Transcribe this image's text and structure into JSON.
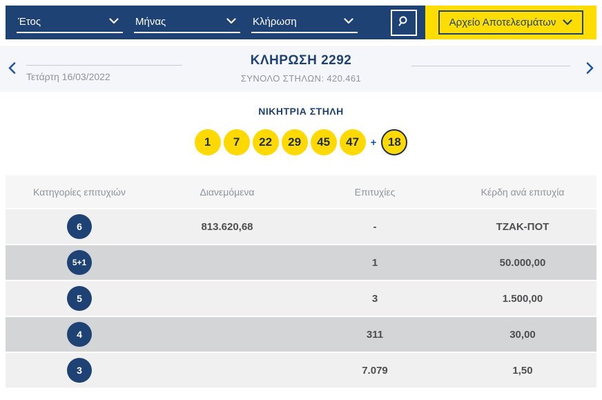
{
  "filters": {
    "year_label": "Έτος",
    "month_label": "Μήνας",
    "draw_label": "Κλήρωση",
    "archive_button_label": "Αρχείο Αποτελεσμάτων"
  },
  "draw_nav": {
    "date": "Τετάρτη 16/03/2022",
    "title": "ΚΛΗΡΩΣΗ 2292",
    "total_columns": "ΣΥΝΟΛΟ ΣΤΗΛΩΝ: 420.461"
  },
  "winning": {
    "title": "ΝΙΚΗΤΡΙΑ ΣΤΗΛΗ",
    "numbers": [
      "1",
      "7",
      "22",
      "29",
      "45",
      "47"
    ],
    "plus_sign": "+",
    "joker_number": "18"
  },
  "table": {
    "headers": [
      "Κατηγορίες επιτυχιών",
      "Διανεμόμενα",
      "Επιτυχίες",
      "Κέρδη ανά επιτυχία"
    ],
    "rows": [
      {
        "category": "6",
        "distributed": "813.620,68",
        "winners": "-",
        "prize": "ΤΖΑΚ-ΠΟΤ"
      },
      {
        "category": "5+1",
        "distributed": "",
        "winners": "1",
        "prize": "50.000,00"
      },
      {
        "category": "5",
        "distributed": "",
        "winners": "3",
        "prize": "1.500,00"
      },
      {
        "category": "4",
        "distributed": "",
        "winners": "311",
        "prize": "30,00"
      },
      {
        "category": "3",
        "distributed": "",
        "winners": "7.079",
        "prize": "1,50"
      }
    ]
  },
  "colors": {
    "navy": "#1d4273",
    "yellow": "#ffdd00",
    "ball_yellow": "#ffd900",
    "row_light": "#f0f0f1",
    "row_dark": "#d4d5d7",
    "band_bg": "#f5f6f9"
  }
}
